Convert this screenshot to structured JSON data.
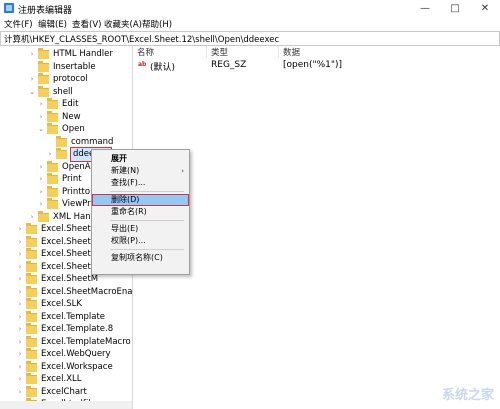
{
  "window": {
    "title": "注册表编辑器",
    "minimize": "—",
    "maximize": "□",
    "close": "✕"
  },
  "menu": [
    "文件(F)",
    "编辑(E)",
    "查看(V)",
    "收藏夹(A)",
    "帮助(H)"
  ],
  "address": "计算机\\HKEY_CLASSES_ROOT\\Excel.Sheet.12\\shell\\Open\\ddeexec",
  "tree": [
    {
      "label": "HTML Handler",
      "level": 2,
      "expandable": true
    },
    {
      "label": "Insertable",
      "level": 2,
      "expandable": false
    },
    {
      "label": "protocol",
      "level": 2,
      "expandable": true
    },
    {
      "label": "shell",
      "level": 2,
      "expandable": true,
      "expanded": true
    },
    {
      "label": "Edit",
      "level": 3,
      "expandable": true
    },
    {
      "label": "New",
      "level": 3,
      "expandable": true
    },
    {
      "label": "Open",
      "level": 3,
      "expandable": true,
      "expanded": true
    },
    {
      "label": "command",
      "level": 4,
      "expandable": false
    },
    {
      "label": "ddeexec",
      "level": 4,
      "expandable": true,
      "selected": true
    },
    {
      "label": "OpenA",
      "level": 3,
      "expandable": true
    },
    {
      "label": "Print",
      "level": 3,
      "expandable": true
    },
    {
      "label": "Printto",
      "level": 3,
      "expandable": true
    },
    {
      "label": "ViewPr",
      "level": 3,
      "expandable": true
    },
    {
      "label": "XML Hand",
      "level": 2,
      "expandable": true
    },
    {
      "label": "Excel.Sheet.5",
      "level": 1,
      "expandable": true
    },
    {
      "label": "Excel.Sheet.8",
      "level": 1,
      "expandable": true
    },
    {
      "label": "Excel.SheetB",
      "level": 1,
      "expandable": true
    },
    {
      "label": "Excel.SheetB",
      "level": 1,
      "expandable": true
    },
    {
      "label": "Excel.SheetM",
      "level": 1,
      "expandable": true
    },
    {
      "label": "Excel.SheetMacroEna",
      "level": 1,
      "expandable": true
    },
    {
      "label": "Excel.SLK",
      "level": 1,
      "expandable": true
    },
    {
      "label": "Excel.Template",
      "level": 1,
      "expandable": true
    },
    {
      "label": "Excel.Template.8",
      "level": 1,
      "expandable": true
    },
    {
      "label": "Excel.TemplateMacro",
      "level": 1,
      "expandable": true
    },
    {
      "label": "Excel.WebQuery",
      "level": 1,
      "expandable": true
    },
    {
      "label": "Excel.Workspace",
      "level": 1,
      "expandable": true
    },
    {
      "label": "Excel.XLL",
      "level": 1,
      "expandable": true
    },
    {
      "label": "ExcelChart",
      "level": 1,
      "expandable": true
    },
    {
      "label": "Excelhtmlfile",
      "level": 1,
      "expandable": true
    }
  ],
  "columns": {
    "name": "名称",
    "type": "类型",
    "data": "数据"
  },
  "values": [
    {
      "icon": "ab",
      "name": "(默认)",
      "type": "REG_SZ",
      "data": "[open(\"%1\")]"
    }
  ],
  "context_menu": {
    "items": [
      {
        "label": "展开",
        "bold": true
      },
      {
        "label": "新建(N)",
        "submenu": "›"
      },
      {
        "label": "查找(F)..."
      },
      {
        "sep": true
      },
      {
        "label": "删除(D)",
        "highlighted": true
      },
      {
        "label": "重命名(R)"
      },
      {
        "sep": true
      },
      {
        "label": "导出(E)"
      },
      {
        "label": "权限(P)..."
      },
      {
        "sep": true
      },
      {
        "label": "复制项名称(C)"
      }
    ]
  },
  "watermark": "系统之家"
}
